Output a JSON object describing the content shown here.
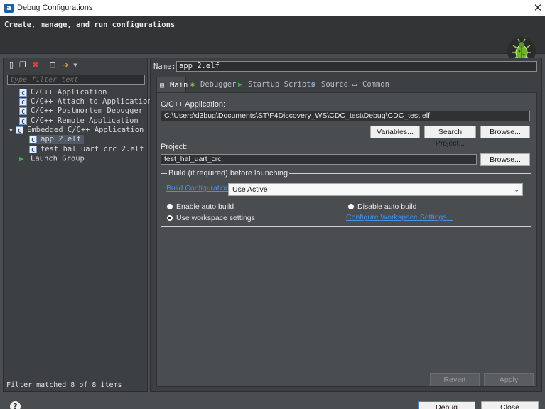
{
  "window": {
    "title": "Debug Configurations",
    "app_icon": "a",
    "close_glyph": "✕"
  },
  "banner": {
    "text": "Create, manage, and run configurations",
    "bug_icon": "bug-icon"
  },
  "left": {
    "toolbar_icons": [
      "new-configuration-icon",
      "duplicate-icon",
      "delete-icon",
      "collapse-all-icon",
      "filter-icon"
    ],
    "filter_placeholder": "type filter text",
    "tree": [
      {
        "label": "C/C++ Application",
        "icon": "c-file-icon"
      },
      {
        "label": "C/C++ Attach to Application",
        "icon": "c-file-icon"
      },
      {
        "label": "C/C++ Postmortem Debugger",
        "icon": "c-file-icon"
      },
      {
        "label": "C/C++ Remote Application",
        "icon": "c-file-icon"
      },
      {
        "label": "Embedded C/C++ Application",
        "icon": "c-file-icon",
        "expanded": true
      },
      {
        "label": "app_2.elf",
        "icon": "c-file-icon",
        "selected": true
      },
      {
        "label": "test_hal_uart_crc_2.elf",
        "icon": "c-file-icon"
      },
      {
        "label": "Launch Group",
        "icon": "launch-group-icon"
      }
    ],
    "status": "Filter matched 8 of 8 items"
  },
  "right": {
    "name_label": "Name:",
    "name_value": "app_2.elf",
    "tabs": [
      {
        "label": "Main",
        "icon": "main-tab-icon",
        "active": true
      },
      {
        "label": "Debugger",
        "icon": "debugger-icon"
      },
      {
        "label": "Startup Scripts",
        "icon": "startup-icon"
      },
      {
        "label": "Source",
        "icon": "source-icon"
      },
      {
        "label": "Common",
        "icon": "common-icon"
      }
    ],
    "main": {
      "app_label": "C/C++ Application:",
      "app_path": "C:\\Users\\d3bug\\Documents\\ST\\F4Discovery_WS\\CDC_test\\Debug\\CDC_test.elf",
      "variables_button": "Variables...",
      "search_project_button": "Search Project...",
      "browse_button": "Browse...",
      "project_label": "Project:",
      "project_value": "test_hal_uart_crc",
      "project_browse_button": "Browse...",
      "build_group_label": "Build (if required) before launching",
      "build_config_link": "Build Configuration:",
      "build_config_value": "Use Active",
      "enable_auto_build": "Enable auto build",
      "disable_auto_build": "Disable auto build",
      "use_workspace_settings": "Use workspace settings",
      "configure_workspace_link": "Configure Workspace Settings...",
      "selected_radio": "use_workspace_settings"
    },
    "revert_button": "Revert",
    "apply_button": "Apply"
  },
  "footer": {
    "help_glyph": "?",
    "debug_button": "Debug",
    "close_button": "Close"
  },
  "colors": {
    "accent_link": "#4a90e2",
    "selection": "#505a66",
    "background": "#4a4d50"
  }
}
